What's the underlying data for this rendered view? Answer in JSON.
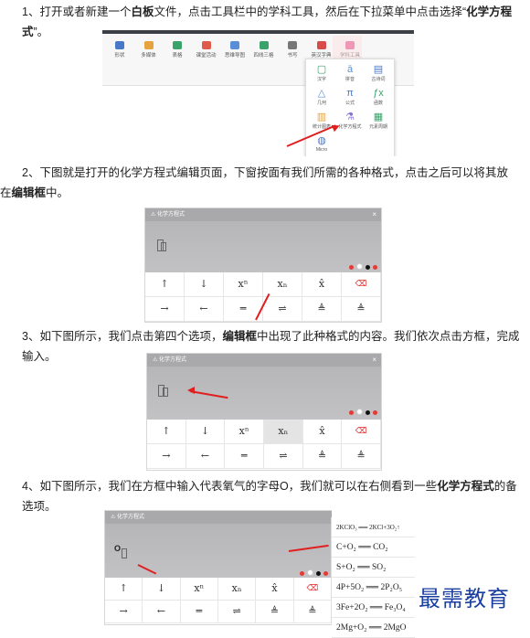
{
  "steps": [
    {
      "num": "1、",
      "pre": "打开或者新建一个",
      "b1": "白板",
      "mid": "文件，点击工具栏中的学科工具，然后在下拉菜单中点击选择“",
      "b2": "化学方程式",
      "post": "”。"
    },
    {
      "num": "2、",
      "pre": "下图就是打开的化学方程式编辑页面，下窗按面有我们所需的各种格式，点击之后可以将其放在",
      "b1": "编辑框",
      "post": "中。"
    },
    {
      "num": "3、",
      "pre": "如下图所示，我们点击第四个选项，",
      "b1": "编辑框",
      "post": "中出现了此种格式的内容。我们依次点击方框，完成输入。"
    },
    {
      "num": "4、",
      "pre": "如下图所示，我们在方框中输入代表氧气的字母O，我们就可以在右侧看到一些",
      "b1": "化学方程式",
      "post": "的备选项。"
    }
  ],
  "toolbar": {
    "items": [
      "形状",
      "多媒体",
      "表格",
      "课堂活动",
      "思维导图",
      "四线三格",
      "书写",
      "英汉字典",
      "学科工具"
    ]
  },
  "dropdown": {
    "items": [
      {
        "glyph": "▢",
        "label": "汉字"
      },
      {
        "glyph": "ā",
        "label": "拼音"
      },
      {
        "glyph": "▤",
        "label": "古诗词"
      },
      {
        "glyph": "△",
        "label": "几何"
      },
      {
        "glyph": "π",
        "label": "公式"
      },
      {
        "glyph": "ƒx",
        "label": "函数"
      },
      {
        "glyph": "▥",
        "label": "统计图表"
      },
      {
        "glyph": "⚗",
        "label": "化学方程式"
      },
      {
        "glyph": "▦",
        "label": "元素周期"
      },
      {
        "glyph": "◍",
        "label": "Micro"
      }
    ]
  },
  "editor": {
    "title": "化学方程式",
    "close": "×",
    "keys_row1": [
      "↑",
      "↓",
      "xⁿ",
      "xₙ",
      "x̂",
      "⌫"
    ],
    "keys_row2": [
      "→",
      "←",
      "═",
      "⇌",
      "≜",
      "≜"
    ],
    "dot_colors": [
      "#e53935",
      "#ffffff",
      "#111111",
      "#e53935"
    ],
    "typed": "O"
  },
  "suggestions": [
    "2KClO₃ ══ 2KCl+3O₂↑",
    "C+O₂ ══ CO₂",
    "S+O₂ ══ SO₂",
    "4P+5O₂ ══ 2P₂O₅",
    "3Fe+2O₂ ══ Fe₃O₄",
    "2Mg+O₂ ══ 2MgO"
  ],
  "watermark": "最需教育"
}
